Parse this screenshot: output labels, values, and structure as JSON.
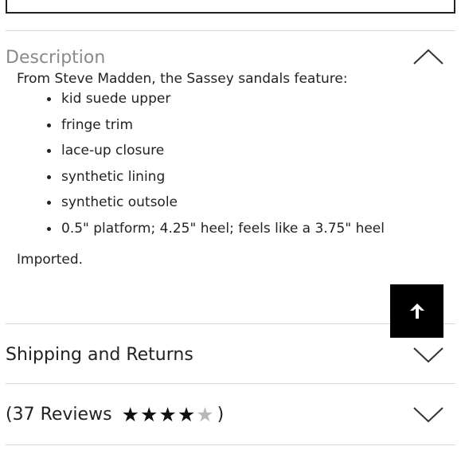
{
  "description": {
    "title": "Description",
    "intro": "From Steve Madden, the Sassey sandals feature:",
    "bullets": [
      "kid suede upper",
      "fringe trim",
      "lace-up closure",
      "synthetic lining",
      "synthetic outsole",
      "0.5\" platform; 4.25\" heel; feels like a 3.75\" heel"
    ],
    "footer": "Imported.",
    "expanded": true,
    "icon": "chevron-up-icon"
  },
  "shipping": {
    "title": "Shipping and Returns",
    "expanded": false,
    "icon": "chevron-down-icon"
  },
  "reviews": {
    "open_paren": "(",
    "label": "37 Reviews",
    "close_paren": ")",
    "rating_filled": 4,
    "rating_max": 5,
    "expanded": false,
    "icon": "chevron-down-icon"
  },
  "scroll_top": {
    "icon": "arrow-up-icon",
    "bg": "#000000"
  }
}
